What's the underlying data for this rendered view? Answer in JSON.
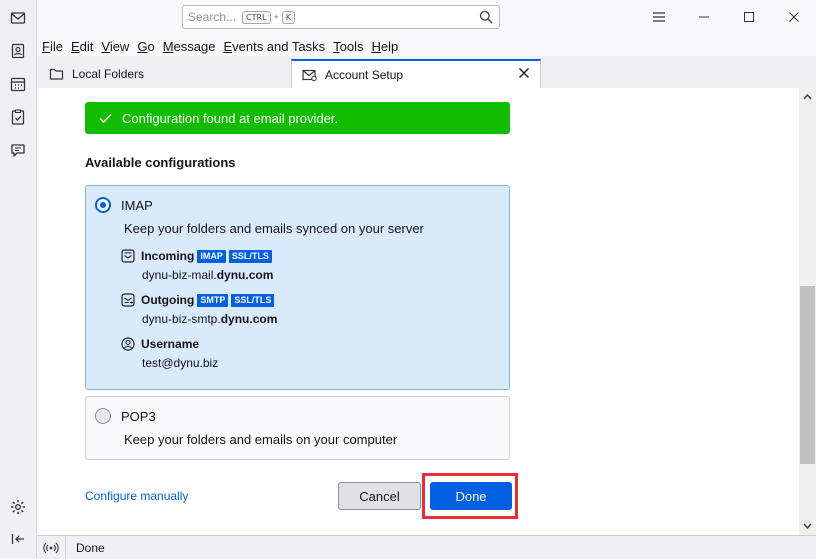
{
  "search": {
    "placeholder": "Search...",
    "key1": "CTRL",
    "plus": "+",
    "key2": "K"
  },
  "menu": [
    "File",
    "Edit",
    "View",
    "Go",
    "Message",
    "Events and Tasks",
    "Tools",
    "Help"
  ],
  "tabs": {
    "local_folders": "Local Folders",
    "account_setup": "Account Setup"
  },
  "notice": "Configuration found at email provider.",
  "available_heading": "Available configurations",
  "imap": {
    "title": "IMAP",
    "desc": "Keep your folders and emails synced on your server",
    "incoming_label": "Incoming",
    "incoming_badges": [
      "IMAP",
      "SSL/TLS"
    ],
    "incoming_host_prefix": "dynu-biz-mail.",
    "incoming_host_domain": "dynu.com",
    "outgoing_label": "Outgoing",
    "outgoing_badges": [
      "SMTP",
      "SSL/TLS"
    ],
    "outgoing_host_prefix": "dynu-biz-smtp.",
    "outgoing_host_domain": "dynu.com",
    "username_label": "Username",
    "username_value": "test@dynu.biz"
  },
  "pop3": {
    "title": "POP3",
    "desc": "Keep your folders and emails on your computer"
  },
  "configure_manually": "Configure manually",
  "cancel": "Cancel",
  "done": "Done",
  "status": "Done",
  "colors": {
    "accent": "#0061e0",
    "success": "#12bc00",
    "highlight": "#e62e36"
  }
}
